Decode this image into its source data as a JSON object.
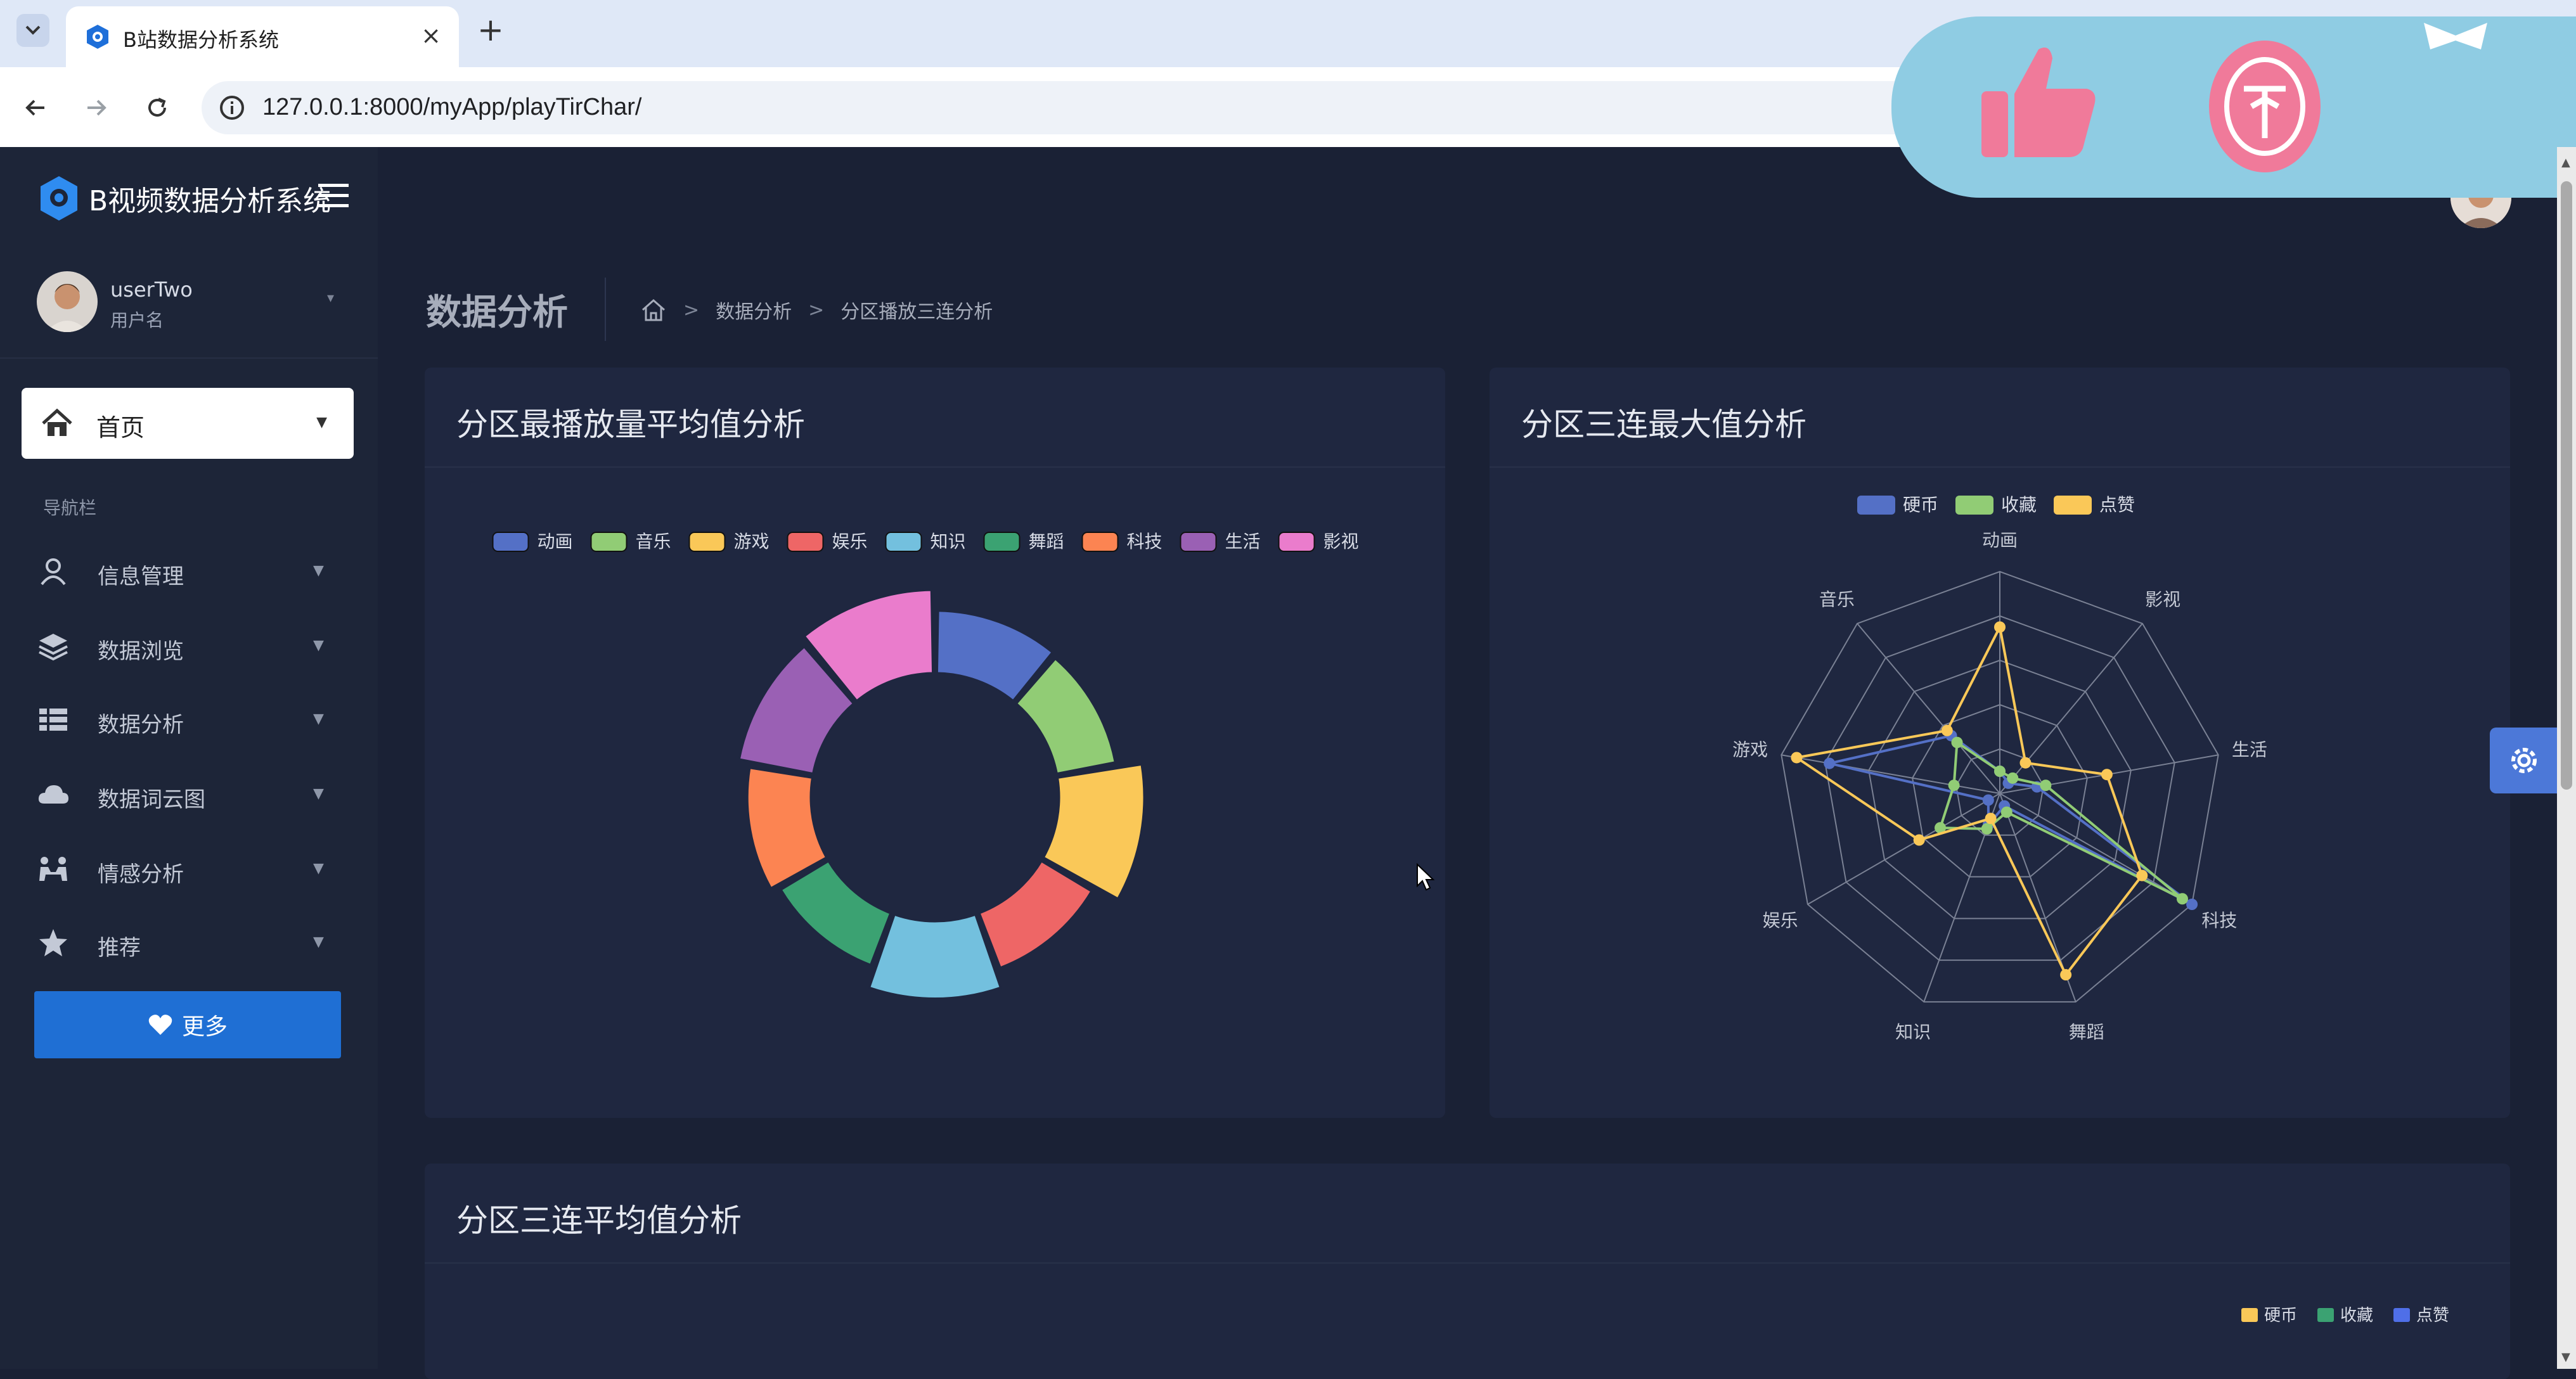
{
  "browser": {
    "tab_title": "B站数据分析系统",
    "url": "127.0.0.1:8000/myApp/playTirChar/"
  },
  "sidebar": {
    "app_title": "B视频数据分析系统",
    "user_name": "userTwo",
    "user_role": "用户名",
    "home_label": "首页",
    "nav_heading": "导航栏",
    "items": [
      {
        "label": "信息管理",
        "icon": "user-icon"
      },
      {
        "label": "数据浏览",
        "icon": "layers-icon"
      },
      {
        "label": "数据分析",
        "icon": "table-icon"
      },
      {
        "label": "数据词云图",
        "icon": "cloud-icon"
      },
      {
        "label": "情感分析",
        "icon": "people-icon"
      },
      {
        "label": "推荐",
        "icon": "star-icon"
      }
    ],
    "more_label": "更多"
  },
  "header": {
    "page_title": "数据分析",
    "breadcrumb": [
      "数据分析",
      "分区播放三连分析"
    ]
  },
  "colors": {
    "blue": "#5470c6",
    "green": "#91cc75",
    "yellow": "#fac858",
    "red": "#ee6666",
    "cyan": "#73c0de",
    "teal": "#3ba272",
    "orange": "#fc8452",
    "purple": "#9a60b4",
    "pink": "#ea7ccc"
  },
  "cards": {
    "donut_title": "分区最播放量平均值分析",
    "radar_title": "分区三连最大值分析",
    "bottom_title": "分区三连平均值分析"
  },
  "chart_data": [
    {
      "type": "pie",
      "variant": "rose-donut",
      "title": "分区最播放量平均值分析",
      "legend": [
        "动画",
        "音乐",
        "游戏",
        "娱乐",
        "知识",
        "舞蹈",
        "科技",
        "生活",
        "影视"
      ],
      "legend_position": "top",
      "values": [
        44,
        38,
        90,
        36,
        74,
        30,
        46,
        70,
        86
      ]
    },
    {
      "type": "radar",
      "title": "分区三连最大值分析",
      "indicators": [
        "动画",
        "影视",
        "生活",
        "科技",
        "舞蹈",
        "知识",
        "娱乐",
        "游戏",
        "音乐"
      ],
      "legend_position": "top",
      "series": [
        {
          "name": "硬币",
          "values": [
            0.1,
            0.06,
            0.17,
            1.0,
            0.06,
            0.15,
            0.06,
            0.78,
            0.34
          ]
        },
        {
          "name": "收藏",
          "values": [
            0.1,
            0.09,
            0.21,
            0.95,
            0.09,
            0.17,
            0.31,
            0.21,
            0.3
          ]
        },
        {
          "name": "点赞",
          "values": [
            0.75,
            0.18,
            0.49,
            0.74,
            0.87,
            0.12,
            0.42,
            0.93,
            0.37
          ]
        }
      ]
    },
    {
      "type": "bar",
      "title": "分区三连平均值分析",
      "series": [
        {
          "name": "硬币"
        },
        {
          "name": "收藏"
        },
        {
          "name": "点赞"
        }
      ],
      "legend_position": "top-right"
    }
  ]
}
